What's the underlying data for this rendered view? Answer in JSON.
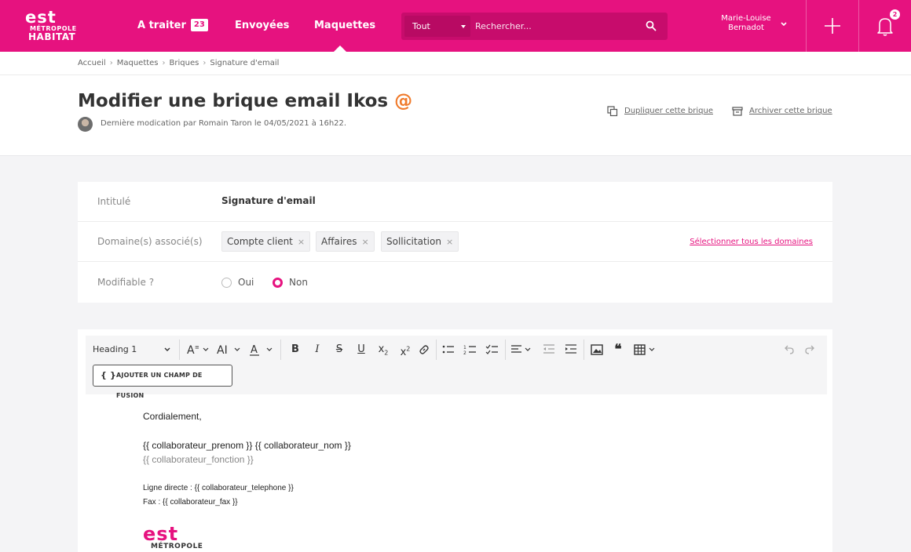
{
  "brand": {
    "accent": "#e6127f",
    "logo_line1": "est",
    "logo_line2": "MÉTROPOLE",
    "logo_line3": "HABITAT"
  },
  "nav": {
    "items": [
      {
        "label": "A traiter",
        "badge": "23"
      },
      {
        "label": "Envoyées"
      },
      {
        "label": "Maquettes"
      }
    ],
    "active": "Maquettes"
  },
  "search": {
    "scope": "Tout",
    "placeholder": "Rechercher..."
  },
  "user": {
    "name_line1": "Marie-Louise",
    "name_line2": "Bernadot"
  },
  "notifications": {
    "count": "2"
  },
  "breadcrumb": [
    "Accueil",
    "Maquettes",
    "Briques",
    "Signature d'email"
  ],
  "header": {
    "title": "Modifier une brique email Ikos",
    "title_suffix": "@",
    "modified": "Dernière modication par Romain Taron le 04/05/2021 à 16h22.",
    "actions": {
      "duplicate": "Dupliquer cette brique",
      "archive": "Archiver cette brique"
    }
  },
  "form": {
    "title_label": "Intitulé",
    "title_value": "Signature d'email",
    "domains_label": "Domaine(s) associé(s)",
    "domains": [
      "Compte client",
      "Affaires",
      "Sollicitation"
    ],
    "select_all": "Sélectionner tous les domaines",
    "editable_label": "Modifiable ?",
    "editable_options": [
      "Oui",
      "Non"
    ],
    "editable_selected": "Non"
  },
  "editor": {
    "block_format": "Heading 1",
    "merge_button": "AJOUTER UN CHAMP DE FUSION",
    "merge_icon": "{ }",
    "content": {
      "greeting": "Cordialement,",
      "name_line": "{{ collaborateur_prenom }} {{ collaborateur_nom }}",
      "function_line": "{{ collaborateur_fonction }}",
      "phone_line": "Ligne directe : {{ collaborateur_telephone }}",
      "fax_line": "Fax : {{ collaborateur_fax }}",
      "logo_line1": "est",
      "logo_line2": "MÉTROPOLE"
    }
  }
}
